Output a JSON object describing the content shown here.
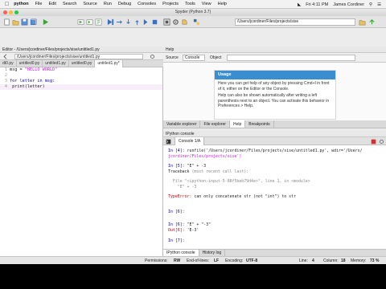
{
  "menubar": {
    "app_name": "python",
    "items": [
      "File",
      "Edit",
      "Search",
      "Source",
      "Run",
      "Debug",
      "Consoles",
      "Projects",
      "Tools",
      "View",
      "Help"
    ],
    "clock": "Fri 4:11 PM",
    "user": "James Cordiner"
  },
  "window": {
    "title": "Spyder (Python 3.7)"
  },
  "toolbar": {
    "workdir": "/Users/jcordiner/Files/projects/sise"
  },
  "editor": {
    "header": "Editor - /Users/jcordiner/Files/projects/sise/untitled1.py",
    "path_box": "/Users/jcordiner/Files/projects/sise/untitled1.py",
    "tabs": [
      "dt0.py",
      "untitled0.py",
      "untitled1.py",
      "untitled0.py",
      "untitled1.py*"
    ],
    "lines": [
      {
        "n": "1",
        "text": "msg = \"HELLO WORLD\""
      },
      {
        "n": "2",
        "text": ""
      },
      {
        "n": "3",
        "text": "for letter in msg:"
      },
      {
        "n": "4",
        "text": "    print(letter)"
      }
    ]
  },
  "help": {
    "header": "Help",
    "source_label": "Source",
    "source_value": "Console",
    "object_label": "Object",
    "usage_title": "Usage",
    "usage_p1": "Here you can get help of any object by pressing Cmd+I in front of it, either on the Editor or the Console.",
    "usage_p2": "Help can also be shown automatically after writing a left parenthesis next to an object. You can activate this behavior in Preferences > Help."
  },
  "right_tabs": [
    "Variable explorer",
    "File explorer",
    "Help",
    "Breakpoints"
  ],
  "console": {
    "header": "IPython console",
    "tab": "Console 1/A",
    "lines": [
      {
        "cls": "prompt-in",
        "text": "In [4]:",
        "rest": " runfile('/Users/jcordiner/Files/projects/sise/untitled1.py', wdir='/Users/"
      },
      {
        "cls": "path",
        "text": "jcordiner/Files/projects/sise')",
        "rest": ""
      },
      {
        "cls": "prompt-in",
        "text": "In [5]:",
        "rest": " \"E\" + -3"
      },
      {
        "cls": "",
        "text": "Traceback",
        "rest": " (most recent call last):"
      },
      {
        "cls": "grey",
        "text": "  File \"<ipython-input-5-08f5beb79d4e>\", line 1, in <module>",
        "rest": ""
      },
      {
        "cls": "grey",
        "text": "    \"E\" + -3",
        "rest": ""
      },
      {
        "cls": "err",
        "text": "TypeError:",
        "rest": " can only concatenate str (not \"int\") to str"
      },
      {
        "cls": "prompt-in",
        "text": "In [6]:",
        "rest": ""
      },
      {
        "cls": "prompt-in",
        "text": "In [6]:",
        "rest": " \"E\" + \"-3\""
      },
      {
        "cls": "prompt-out",
        "text": "Out[6]:",
        "rest": " 'E-3'"
      },
      {
        "cls": "prompt-in",
        "text": "In [7]:",
        "rest": ""
      }
    ]
  },
  "bottom_tabs": [
    "IPython console",
    "History log"
  ],
  "statusbar": {
    "perm_label": "Permissions:",
    "perm_value": "RW",
    "eol_label": "End-of-lines:",
    "eol_value": "LF",
    "enc_label": "Encoding:",
    "enc_value": "UTF-8",
    "line_label": "Line:",
    "line_value": "4",
    "col_label": "Column:",
    "col_value": "18",
    "mem_label": "Memory:",
    "mem_value": "73 %"
  }
}
